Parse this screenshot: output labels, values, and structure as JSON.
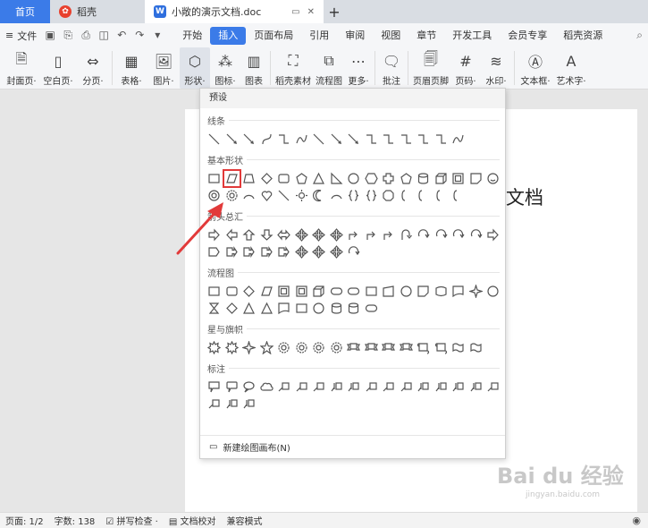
{
  "tabs": [
    {
      "label": "首页"
    },
    {
      "label": "稻壳"
    },
    {
      "label": "小敞的演示文档.doc"
    }
  ],
  "menu": {
    "file_label": "文件",
    "tabs": [
      "开始",
      "插入",
      "页面布局",
      "引用",
      "审阅",
      "视图",
      "章节",
      "开发工具",
      "会员专享",
      "稻壳资源"
    ],
    "active_tab": "插入"
  },
  "ribbon": {
    "items": [
      {
        "label": "封面页·",
        "icon": "cover-page-icon"
      },
      {
        "label": "空白页·",
        "icon": "blank-page-icon"
      },
      {
        "label": "分页·",
        "icon": "page-break-icon"
      },
      {
        "label": "表格·",
        "icon": "table-icon"
      },
      {
        "label": "图片·",
        "icon": "picture-icon"
      },
      {
        "label": "形状·",
        "icon": "shape-icon"
      },
      {
        "label": "图标·",
        "icon": "icons-icon"
      },
      {
        "label": "图表",
        "icon": "chart-icon"
      },
      {
        "label": "稻壳素材",
        "icon": "material-icon"
      },
      {
        "label": "流程图",
        "icon": "flowchart-icon"
      },
      {
        "label": "更多·",
        "icon": "more-icon"
      },
      {
        "label": "批注",
        "icon": "comment-icon"
      },
      {
        "label": "页眉页脚",
        "icon": "header-footer-icon"
      },
      {
        "label": "页码·",
        "icon": "page-number-icon"
      },
      {
        "label": "水印·",
        "icon": "watermark-icon"
      },
      {
        "label": "文本框·",
        "icon": "textbox-icon"
      },
      {
        "label": "艺术字·",
        "icon": "wordart-icon"
      }
    ]
  },
  "document": {
    "title_text": "文档"
  },
  "shapes_dropdown": {
    "header": "预设",
    "sections": [
      {
        "title": "线条"
      },
      {
        "title": "基本形状"
      },
      {
        "title": "箭头总汇"
      },
      {
        "title": "流程图"
      },
      {
        "title": "星与旗帜"
      },
      {
        "title": "标注"
      }
    ],
    "selected_shape": "parallelogram",
    "footer": "新建绘图画布(N)"
  },
  "watermark": {
    "brand": "Bai du 经验",
    "url": "jingyan.baidu.com"
  },
  "statusbar": {
    "page": "页面: 1/2",
    "words": "字数: 138",
    "spell": "拼写检查 ·",
    "proof": "文档校对",
    "compat": "兼容模式"
  },
  "colors": {
    "accent": "#3b7be8",
    "highlight": "#e23a3a"
  }
}
